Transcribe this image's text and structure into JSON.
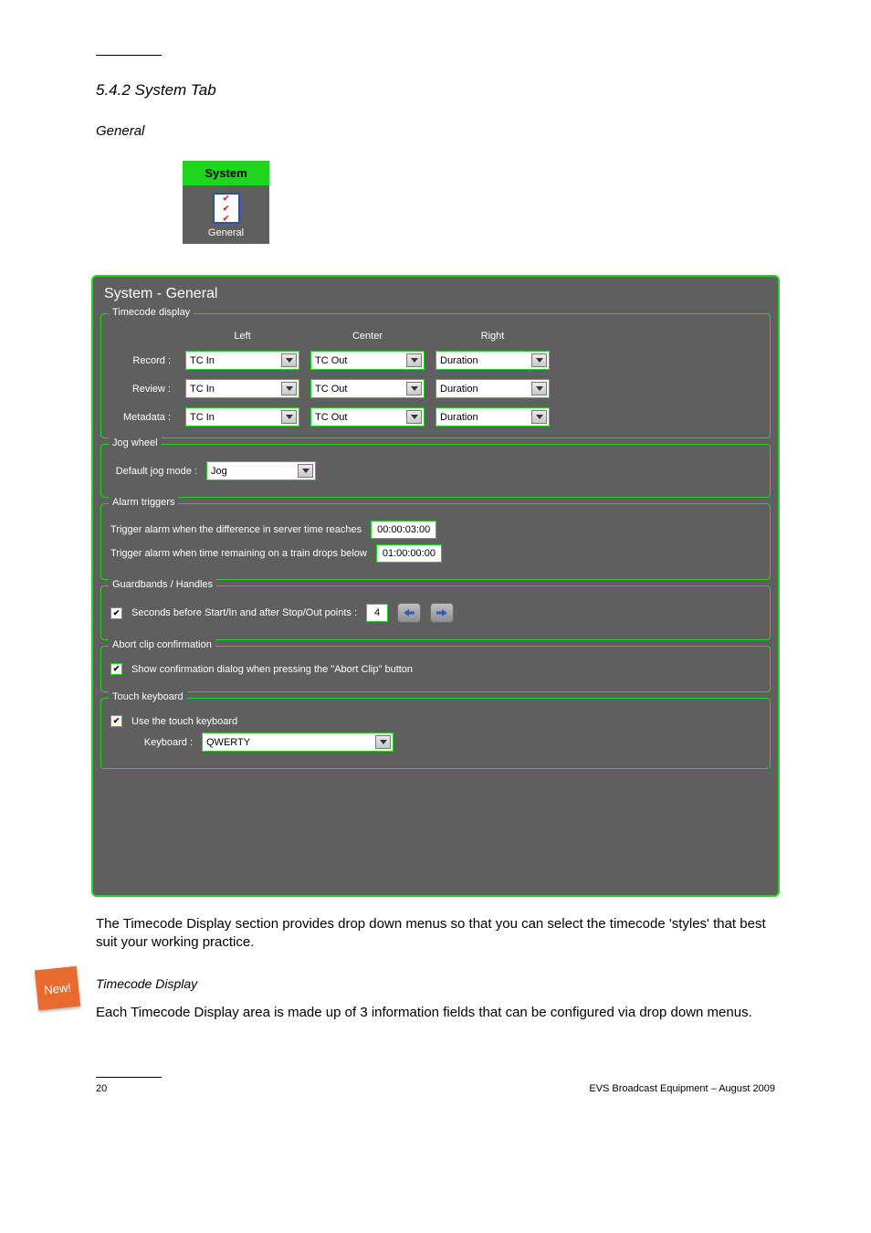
{
  "page": {
    "section_number_title": "5.4.2 System Tab",
    "subsection_title": "General",
    "body_text_1": "The Timecode Display section provides drop down menus so that you can select the timecode 'styles' that best suit your working practice.",
    "heading_4": "Timecode Display",
    "body_text_2": "Each Timecode Display area is made up of 3 information fields that can be configured via drop down menus.",
    "footer_left": "20",
    "footer_right": "EVS Broadcast Equipment – August 2009"
  },
  "tab_figure": {
    "tab_head": "System",
    "general_label": "General"
  },
  "new_badge": "New!",
  "panel": {
    "title": "System - General",
    "groups": {
      "timecode_display": {
        "legend": "Timecode display",
        "cols": {
          "left": "Left",
          "center": "Center",
          "right": "Right"
        },
        "rows": {
          "record": {
            "label": "Record :",
            "left": "TC In",
            "center": "TC Out",
            "right": "Duration"
          },
          "review": {
            "label": "Review :",
            "left": "TC In",
            "center": "TC Out",
            "right": "Duration"
          },
          "metadata": {
            "label": "Metadata :",
            "left": "TC In",
            "center": "TC Out",
            "right": "Duration"
          }
        }
      },
      "jog_wheel": {
        "legend": "Jog wheel",
        "default_mode_label": "Default jog mode :",
        "default_mode_value": "Jog"
      },
      "alarm_triggers": {
        "legend": "Alarm triggers",
        "line1_label": "Trigger alarm when the difference in server time reaches",
        "line1_value": "00:00:03:00",
        "line2_label": "Trigger alarm when time remaining on a train drops below",
        "line2_value": "01:00:00:00"
      },
      "guardbands": {
        "legend": "Guardbands / Handles",
        "checkbox_label": "Seconds before Start/In and after Stop/Out points :",
        "value": "4"
      },
      "abort": {
        "legend": "Abort clip confirmation",
        "checkbox_label": "Show confirmation dialog when pressing the \"Abort Clip\" button"
      },
      "touch_keyboard": {
        "legend": "Touch keyboard",
        "checkbox_label": "Use the touch keyboard",
        "keyboard_label": "Keyboard :",
        "keyboard_value": "QWERTY"
      }
    }
  }
}
